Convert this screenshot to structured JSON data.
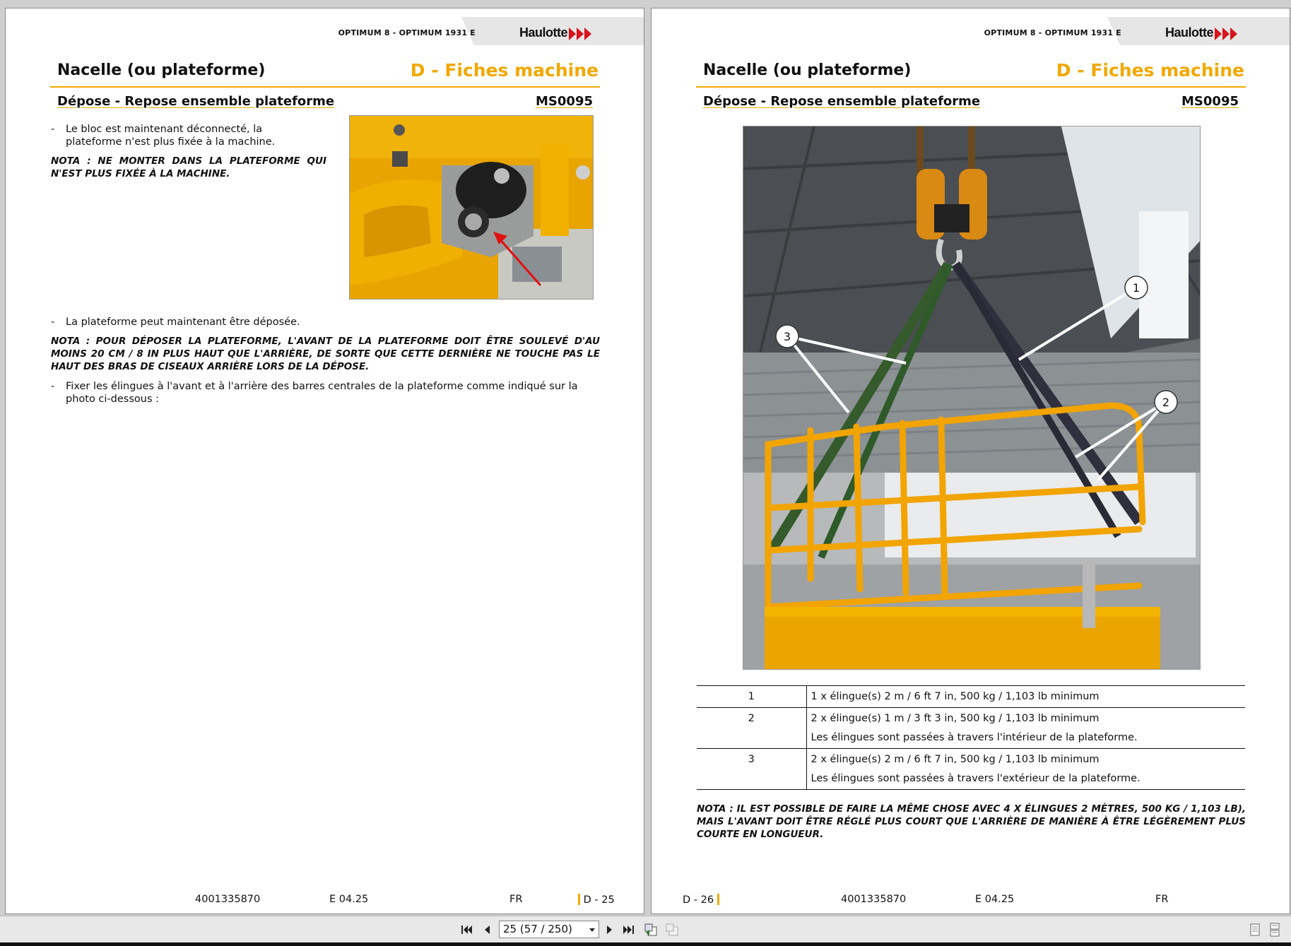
{
  "header": {
    "model": "OPTIMUM 8 - OPTIMUM 1931 E",
    "brand": "Haulotte"
  },
  "left_page": {
    "section_title": "Nacelle (ou plateforme)",
    "chapter_title": "D - Fiches machine",
    "subsection_title": "Dépose - Repose ensemble plateforme",
    "subsection_code": "MS0095",
    "bullet1": "Le bloc est maintenant déconnecté, la plateforme n'est plus fixée à la machine.",
    "nota1": "NOTA  : NE MONTER DANS LA PLATEFORME QUI N'EST PLUS FIXÉE À LA MACHINE.",
    "bullet2": "La plateforme peut maintenant être déposée.",
    "nota2": "NOTA  : POUR DÉPOSER LA PLATEFORME, L'AVANT DE LA PLATEFORME DOIT ÊTRE SOULEVÉ D'AU MOINS 20 CM / 8 IN PLUS HAUT QUE L'ARRIÈRE, DE SORTE QUE CETTE DERNIÈRE NE TOUCHE PAS LE HAUT DES BRAS DE CISEAUX ARRIÈRE LORS DE LA DÉPOSE.",
    "bullet3": "Fixer les élingues à l'avant et à l'arrière des barres centrales de la plateforme comme indiqué sur la photo ci-dessous :",
    "footer": {
      "docnum": "4001335870",
      "edition": "E 04.25",
      "lang": "FR",
      "page": "D - 25"
    }
  },
  "right_page": {
    "section_title": "Nacelle (ou plateforme)",
    "chapter_title": "D - Fiches machine",
    "subsection_title": "Dépose - Repose ensemble plateforme",
    "subsection_code": "MS0095",
    "callouts": [
      "1",
      "2",
      "3"
    ],
    "legend": [
      {
        "num": "1",
        "line1": "1 x élingue(s) 2 m / 6 ft 7 in, 500 kg / 1,103 lb minimum",
        "line2": ""
      },
      {
        "num": "2",
        "line1": "2 x élingue(s) 1 m / 3 ft 3 in, 500 kg / 1,103 lb minimum",
        "line2": "Les élingues sont passées à travers l'intérieur de la plateforme."
      },
      {
        "num": "3",
        "line1": "2 x élingue(s) 2 m / 6 ft 7 in, 500 kg / 1,103 lb minimum",
        "line2": "Les élingues sont passées à travers l'extérieur de la plateforme."
      }
    ],
    "nota": "NOTA  : IL EST POSSIBLE DE FAIRE LA MÊME CHOSE AVEC 4 X ÉLINGUES 2 MÈTRES, 500 KG / 1,103 LB), MAIS L'AVANT DOIT ÊTRE RÉGLÉ PLUS COURT QUE L'ARRIÈRE DE MANIÈRE À ÊTRE LÉGÈREMENT PLUS COURTE EN LONGUEUR.",
    "footer": {
      "page": "D - 26",
      "docnum": "4001335870",
      "edition": "E 04.25",
      "lang": "FR"
    }
  },
  "toolbar": {
    "page_indicator": "25 (57 / 250)",
    "icons": [
      "first-page-icon",
      "prev-page-icon",
      "next-page-icon",
      "last-page-icon",
      "back-view-icon",
      "forward-view-icon",
      "single-page-icon",
      "continuous-page-icon"
    ]
  },
  "colors": {
    "accent": "#f2a800",
    "brand_red": "#d7131b",
    "page_bg": "#ffffff",
    "viewer_bg": "#cfcfcf"
  }
}
